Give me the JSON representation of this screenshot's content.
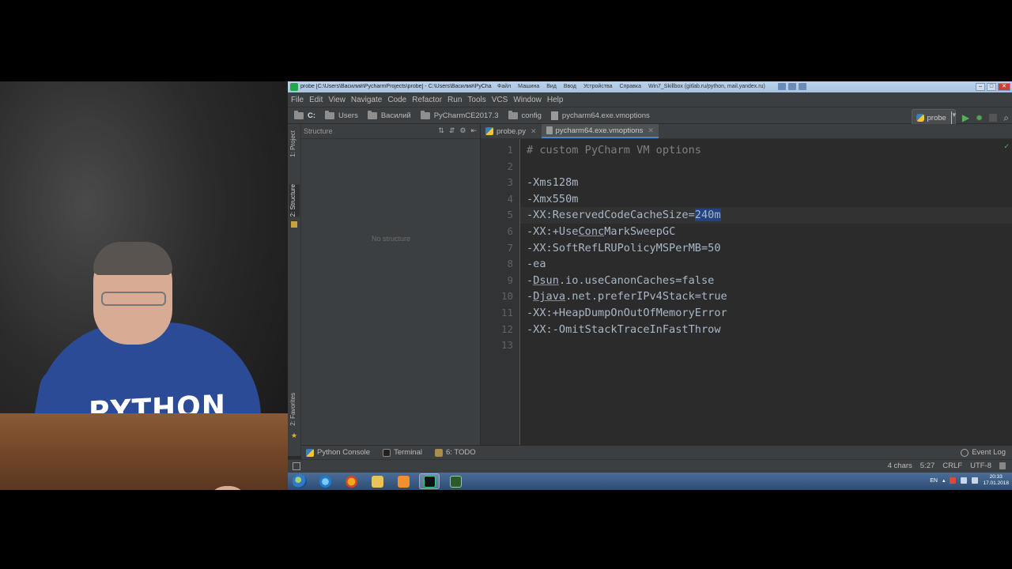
{
  "window": {
    "title": "probe [C:\\Users\\Василий\\PycharmProjects\\probe] - C:\\Users\\Василий\\PyCha",
    "vm_menus": [
      "Файл",
      "Машина",
      "Вид",
      "Ввод",
      "Устройства",
      "Справка",
      "Win7_Skillbox (gitlab.ru/python, mail.yandex.ru)"
    ]
  },
  "menu": [
    "File",
    "Edit",
    "View",
    "Navigate",
    "Code",
    "Refactor",
    "Run",
    "Tools",
    "VCS",
    "Window",
    "Help"
  ],
  "breadcrumb": [
    "C:",
    "Users",
    "Василий",
    "PyCharmCE2017.3",
    "config",
    "pycharm64.exe.vmoptions"
  ],
  "run_config": {
    "label": "probe"
  },
  "left_tabs": [
    "1: Project",
    "2: Structure",
    "2: Favorites"
  ],
  "structure": {
    "title": "Structure",
    "empty_text": "No structure"
  },
  "editor_tabs": [
    {
      "label": "probe.py",
      "active": false
    },
    {
      "label": "pycharm64.exe.vmoptions",
      "active": true
    }
  ],
  "editor": {
    "lines": [
      "# custom PyCharm VM options",
      "",
      "-Xms128m",
      "-Xmx550m",
      "-XX:ReservedCodeCacheSize=240m",
      "-XX:+UseConcMarkSweepGC",
      "-XX:SoftRefLRUPolicyMSPerMB=50",
      "-ea",
      "-Dsun.io.useCanonCaches=false",
      "-Djava.net.preferIPv4Stack=true",
      "-XX:+HeapDumpOnOutOfMemoryError",
      "-XX:-OmitStackTraceInFastThrow",
      ""
    ],
    "line_numbers": [
      "1",
      "2",
      "3",
      "4",
      "5",
      "6",
      "7",
      "8",
      "9",
      "10",
      "11",
      "12",
      "13"
    ],
    "current_line": 5,
    "selected_text": "240m"
  },
  "bottom_tabs": [
    "Python Console",
    "Terminal",
    "6: TODO"
  ],
  "event_log": "Event Log",
  "status": {
    "selection": "4 chars",
    "position": "5:27",
    "line_sep": "CRLF",
    "encoding": "UTF-8"
  },
  "taskbar": {
    "lang": "EN",
    "time": "20:33",
    "date": "17.01.2018"
  },
  "shirt_text": "PYTHON"
}
